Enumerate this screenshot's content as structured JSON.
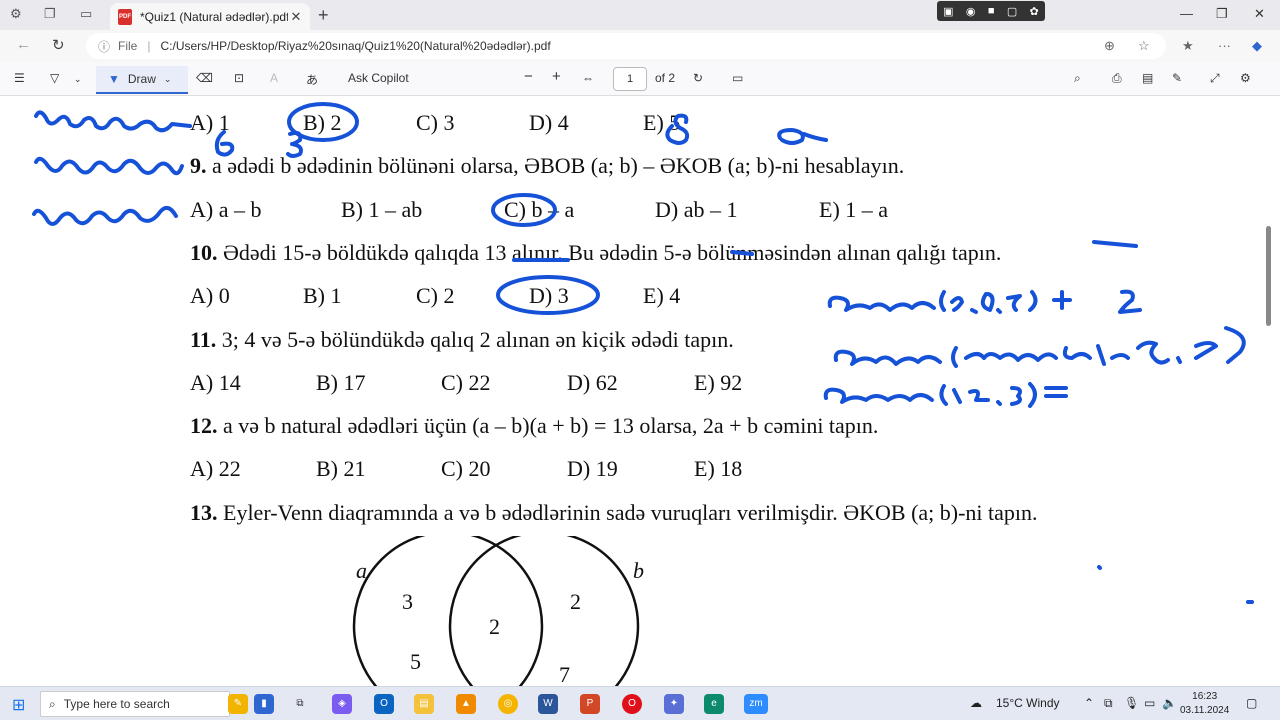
{
  "browser": {
    "tab_title": "*Quiz1 (Natural ədədlər).pdf",
    "tab_close": "✕",
    "new_tab": "+",
    "url_label": "File",
    "url": "C:/Users/HP/Desktop/Riyaz%20sınaq/Quiz1%20(Natural%20ədədlər).pdf"
  },
  "pdf_toolbar": {
    "draw_label": "Draw",
    "ask_copilot": "Ask Copilot",
    "page_current": "1",
    "page_total": "of 2"
  },
  "questions": {
    "q8_options": [
      "A) 1",
      "B) 2",
      "C) 3",
      "D) 4",
      "E) 5"
    ],
    "q9": {
      "num": "9.",
      "text": "a ədədi b ədədinin bölünəni olarsa, ƏBOB (a; b) – ƏKOB (a; b)-ni hesablayın."
    },
    "q9_options": [
      "A) a – b",
      "B) 1 – ab",
      "C) b – a",
      "D) ab – 1",
      "E) 1 – a"
    ],
    "q10": {
      "num": "10.",
      "text": "Ədədi 15-ə böldükdə qalıqda 13 alınır. Bu ədədin 5-ə bölünməsindən alınan qalığı tapın."
    },
    "q10_options": [
      "A) 0",
      "B) 1",
      "C) 2",
      "D) 3",
      "E) 4"
    ],
    "q11": {
      "num": "11.",
      "text": "3; 4 və 5-ə bölündükdə qalıq 2 alınan ən kiçik ədədi tapın."
    },
    "q11_options": [
      "A) 14",
      "B) 17",
      "C) 22",
      "D) 62",
      "E) 92"
    ],
    "q12": {
      "num": "12.",
      "text": "a və b  natural ədədləri üçün (a – b)(a + b) = 13 olarsa, 2a + b cəmini tapın."
    },
    "q12_options": [
      "A) 22",
      "B) 21",
      "C) 20",
      "D) 19",
      "E) 18"
    ],
    "q13": {
      "num": "13.",
      "text": "Eyler-Venn diaqramında a və b ədədlərinin sadə vuruqları verilmişdir. ƏKOB (a; b)-ni tapın."
    }
  },
  "venn": {
    "label_a": "a",
    "label_b": "b",
    "left_only": [
      "3",
      "5"
    ],
    "intersection": [
      "2"
    ],
    "right_only": [
      "2",
      "7"
    ]
  },
  "taskbar": {
    "search_placeholder": "Type here to search",
    "weather": "15°C  Windy",
    "time": "16:23",
    "date": "03.11.2024"
  },
  "colors": {
    "ink": "#1652d8",
    "accent": "#2f66d0"
  }
}
